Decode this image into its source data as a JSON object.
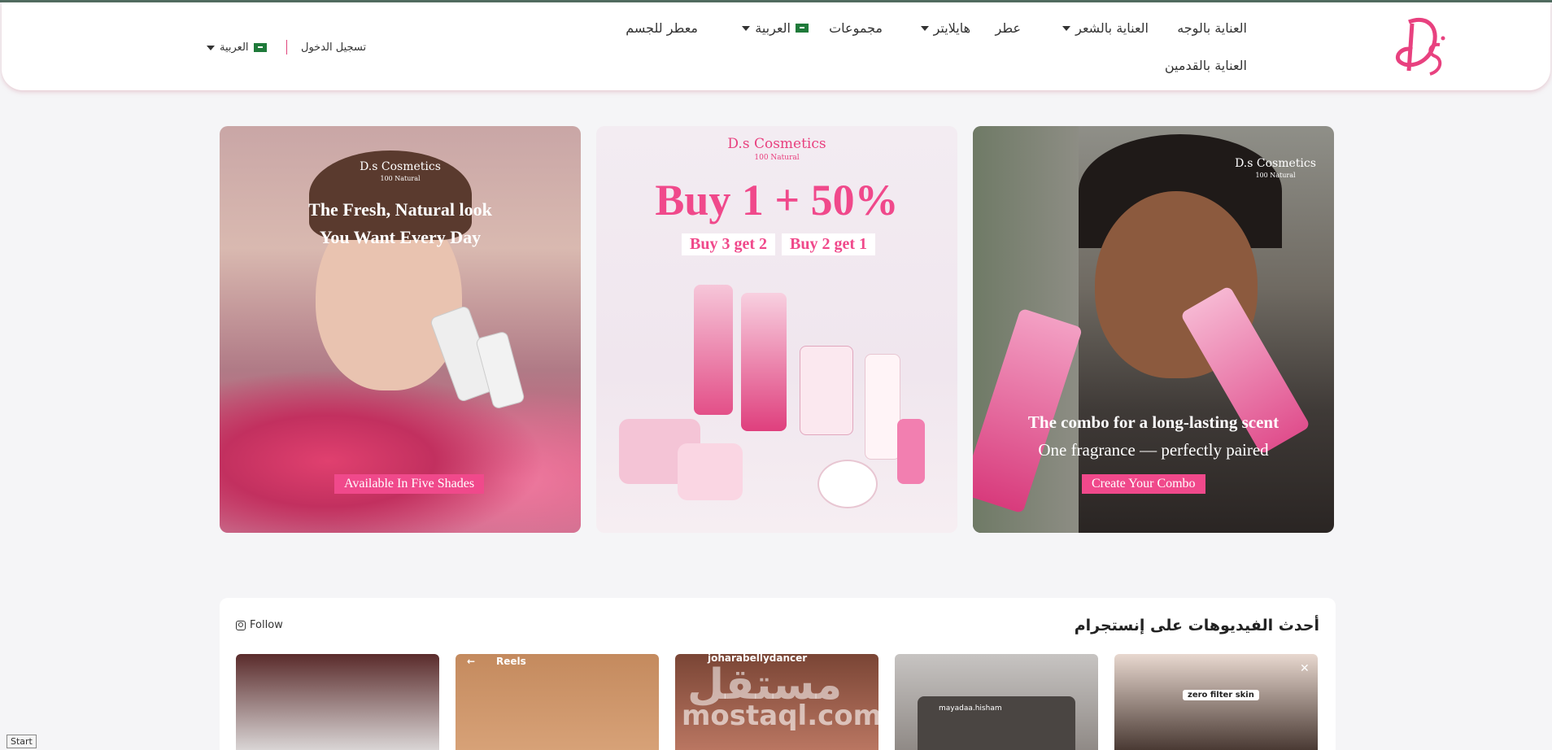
{
  "nav": {
    "row1": [
      "العناية بالوجه",
      "العناية بالشعر",
      "عطر",
      "هايلايتر",
      "مجموعات",
      "العربية",
      "معطر للجسم"
    ],
    "row2": "العناية بالقدمين"
  },
  "utility": {
    "login": "تسجيل الدخول",
    "language": "العربية"
  },
  "banners": [
    {
      "brand": "D.s Cosmetics",
      "sub": "100 Natural",
      "line1": "The Fresh, Natural look",
      "line2": "You Want Every Day",
      "cta": "Available In Five Shades"
    },
    {
      "brand": "D.s Cosmetics",
      "sub": "100 Natural",
      "headline": "Buy 1 + 50%",
      "tag1": "Buy 3 get 2",
      "tag2": "Buy 2 get 1"
    },
    {
      "brand": "D.s Cosmetics",
      "sub": "100 Natural",
      "line1": "The combo for a long-lasting scent",
      "line2": "One fragrance — perfectly paired",
      "cta": "Create Your Combo"
    }
  ],
  "instagram": {
    "title": "أحدث الفيديوهات على إنستجرام",
    "follow": "Follow",
    "reels": [
      {
        "label": ""
      },
      {
        "label": "Reels"
      },
      {
        "label": "joharabellydancer"
      },
      {
        "label": "mayadaa.hisham"
      },
      {
        "label": "zero filter skin"
      }
    ]
  },
  "watermark": {
    "ar": "مستقل",
    "en": "mostaql.com"
  },
  "taskbar": {
    "start": "Start"
  },
  "colors": {
    "accent": "#f0498b",
    "brand_pink": "#e8417f",
    "header_line": "#4d6b5e"
  }
}
